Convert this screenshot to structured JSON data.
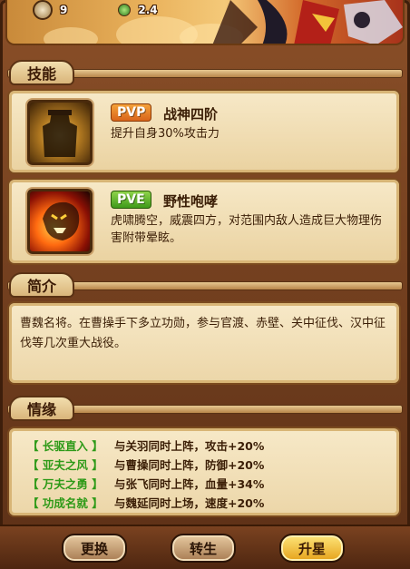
{
  "banner": {
    "stat1_value": "9",
    "stat2_value": "2.4"
  },
  "skills_section": {
    "title": "技能",
    "skills": [
      {
        "mode": "PVP",
        "name": "战神四阶",
        "desc": "提升自身30%攻击力"
      },
      {
        "mode": "PVE",
        "name": "野性咆哮",
        "desc": "虎啸腾空，威震四方，对范围内敌人造成巨大物理伤害附带晕眩。"
      }
    ]
  },
  "intro_section": {
    "title": "简介",
    "text": "曹魏名将。在曹操手下多立功勋，参与官渡、赤壁、关中征伐、汉中征伐等几次重大战役。"
  },
  "bonds_section": {
    "title": "情缘",
    "bonds": [
      {
        "name": "【 长驱直入 】",
        "desc": "与关羽同时上阵，攻击+20%"
      },
      {
        "name": "【 亚夫之风 】",
        "desc": "与曹操同时上阵，防御+20%"
      },
      {
        "name": "【 万夫之勇 】",
        "desc": "与张飞同时上阵，血量+34%"
      },
      {
        "name": "【 功成名就 】",
        "desc": "与魏延同时上场，速度+20%"
      }
    ]
  },
  "buttons": {
    "swap": "更换",
    "rebirth": "转生",
    "star_up": "升星"
  },
  "colors": {
    "pvp": "#e8841f",
    "pve": "#5bb52a",
    "bond_name": "#2e9a18",
    "text": "#3b1e06"
  }
}
